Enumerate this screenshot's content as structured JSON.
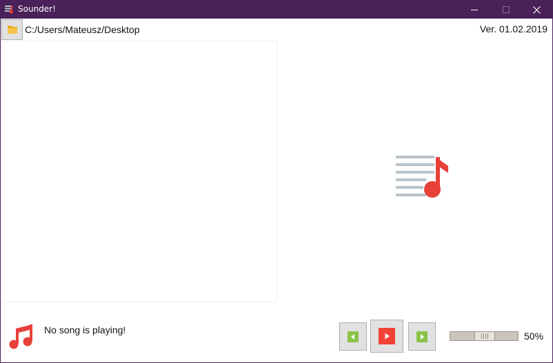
{
  "window": {
    "title": "Sounder!",
    "accent": "#4a2159",
    "icons": {
      "app": "sounder-app-icon",
      "minimize": "minimize-icon",
      "maximize": "maximize-icon",
      "close": "close-icon"
    }
  },
  "toolbar": {
    "folder_icon": "folder-icon",
    "path": "C:/Users/Mateusz/Desktop",
    "version": "Ver. 01.02.2019"
  },
  "playlist": {
    "items": []
  },
  "artwork": {
    "icon": "playlist-music-icon",
    "note_color": "#e8413a",
    "lines_color": "#b7c4ca"
  },
  "now_playing": {
    "icon": "music-note-icon",
    "text": "No song is playing!"
  },
  "controls": {
    "previous": {
      "icon": "previous-icon",
      "color": "#8bc34a"
    },
    "play": {
      "icon": "play-icon",
      "color": "#f44336"
    },
    "next": {
      "icon": "next-icon",
      "color": "#8bc34a"
    }
  },
  "volume": {
    "value": 50,
    "label": "50%"
  }
}
